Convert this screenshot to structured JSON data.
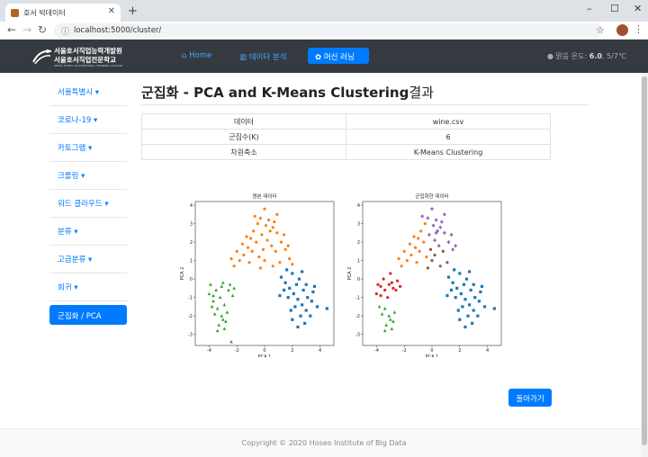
{
  "browser": {
    "tab_title": "호서 빅데이터",
    "url": "localhost:5000/cluster/",
    "new_tab": "+",
    "minimize": "–",
    "maximize": "☐",
    "close": "✕"
  },
  "navbar": {
    "logo_line1": "서울호서직업능력개발원",
    "logo_line2": "서울호서직업전문학교",
    "logo_line3": "SEOUL HOSEO OCCUPATIONAL TRAINING COLLEGE",
    "home_label": "Home",
    "analysis_label": "데이터 분석",
    "ml_label": "머신 러닝",
    "weather_prefix": "맑음 온도:",
    "weather_temp": "6.0",
    "weather_range": ", 5/7℃"
  },
  "sidebar": {
    "items": [
      {
        "label": "서울특별시 ▾"
      },
      {
        "label": "코로나-19 ▾"
      },
      {
        "label": "카토그램 ▾"
      },
      {
        "label": "크롤링 ▾"
      },
      {
        "label": "워드 클라우드 ▾"
      },
      {
        "label": "분류 ▾"
      },
      {
        "label": "고급분류 ▾"
      },
      {
        "label": "회귀 ▾"
      },
      {
        "label": "군집화 / PCA"
      }
    ]
  },
  "main": {
    "title_bold": "군집화 - PCA and K-Means Clustering",
    "title_rest": "결과",
    "table": [
      [
        "데이터",
        "wine.csv"
      ],
      [
        "군집수(K)",
        "6"
      ],
      [
        "차원축소",
        "K-Means Clustering"
      ]
    ],
    "back_label": "돌아가기"
  },
  "chart_data": [
    {
      "type": "scatter",
      "title": "원본 데이터",
      "xlabel": "PCA 1",
      "ylabel": "PCA 2",
      "xlim": [
        -5,
        5
      ],
      "ylim": [
        -3.6,
        4.2
      ],
      "xticks": [
        -4,
        -2,
        0,
        2,
        4
      ],
      "yticks": [
        -3,
        -2,
        -1,
        0,
        1,
        2,
        3,
        4
      ],
      "series": [
        {
          "color": "#ff7f0e",
          "marker": "circle",
          "points": [
            [
              -2.2,
              0.7
            ],
            [
              -1.8,
              1.0
            ],
            [
              -1.5,
              1.3
            ],
            [
              -1.2,
              1.7
            ],
            [
              -1.0,
              2.2
            ],
            [
              -0.8,
              2.6
            ],
            [
              -0.5,
              3.0
            ],
            [
              -0.3,
              3.3
            ],
            [
              0.0,
              3.8
            ],
            [
              0.3,
              3.2
            ],
            [
              0.6,
              2.8
            ],
            [
              0.9,
              2.5
            ],
            [
              1.2,
              2.0
            ],
            [
              1.5,
              1.6
            ],
            [
              1.8,
              1.1
            ],
            [
              2.0,
              0.8
            ],
            [
              -0.6,
              2.0
            ],
            [
              -0.2,
              2.4
            ],
            [
              0.2,
              2.1
            ],
            [
              0.5,
              1.8
            ],
            [
              -0.9,
              1.5
            ],
            [
              -1.3,
              2.3
            ],
            [
              -0.4,
              1.2
            ],
            [
              0.8,
              1.5
            ],
            [
              1.1,
              0.9
            ],
            [
              0.1,
              2.9
            ],
            [
              -1.6,
              1.9
            ],
            [
              -2.0,
              1.5
            ],
            [
              0.7,
              3.1
            ],
            [
              -0.1,
              1.6
            ],
            [
              1.4,
              2.4
            ],
            [
              -0.7,
              3.4
            ],
            [
              0.4,
              2.6
            ],
            [
              -1.1,
              0.9
            ],
            [
              0.0,
              1.0
            ],
            [
              1.7,
              1.8
            ],
            [
              -2.4,
              1.1
            ],
            [
              0.9,
              3.5
            ],
            [
              -0.3,
              0.6
            ],
            [
              0.6,
              0.7
            ]
          ]
        },
        {
          "color": "#1f77b4",
          "marker": "square",
          "points": [
            [
              1.2,
              0.1
            ],
            [
              1.5,
              -0.2
            ],
            [
              1.8,
              -0.5
            ],
            [
              2.1,
              -0.8
            ],
            [
              2.4,
              -1.1
            ],
            [
              2.7,
              -1.4
            ],
            [
              3.0,
              -1.7
            ],
            [
              3.3,
              -2.0
            ],
            [
              2.0,
              0.3
            ],
            [
              2.5,
              0.0
            ],
            [
              3.0,
              -0.3
            ],
            [
              3.5,
              -0.7
            ],
            [
              1.7,
              -1.0
            ],
            [
              2.2,
              -1.5
            ],
            [
              2.8,
              -0.6
            ],
            [
              3.4,
              -1.2
            ],
            [
              1.4,
              -0.6
            ],
            [
              2.6,
              -2.0
            ],
            [
              3.8,
              -1.5
            ],
            [
              1.9,
              -1.7
            ],
            [
              2.3,
              -0.3
            ],
            [
              3.1,
              -1.0
            ],
            [
              2.9,
              -2.4
            ],
            [
              1.6,
              0.5
            ],
            [
              2.4,
              -2.6
            ],
            [
              3.6,
              -0.4
            ],
            [
              1.1,
              -0.9
            ],
            [
              4.5,
              -1.6
            ],
            [
              2.0,
              -2.2
            ],
            [
              2.7,
              0.4
            ]
          ]
        },
        {
          "color": "#2ca02c",
          "marker": "triangle",
          "points": [
            [
              -4.0,
              -0.8
            ],
            [
              -3.7,
              -1.2
            ],
            [
              -3.4,
              -1.6
            ],
            [
              -3.1,
              -2.0
            ],
            [
              -2.8,
              -2.3
            ],
            [
              -3.9,
              -0.3
            ],
            [
              -3.5,
              -0.6
            ],
            [
              -3.2,
              -1.0
            ],
            [
              -2.9,
              -1.4
            ],
            [
              -3.6,
              -1.9
            ],
            [
              -3.0,
              -0.2
            ],
            [
              -2.6,
              -0.6
            ],
            [
              -2.3,
              -0.9
            ],
            [
              -3.3,
              -2.5
            ],
            [
              -2.7,
              -1.8
            ],
            [
              -3.8,
              -1.5
            ],
            [
              -3.1,
              -0.4
            ],
            [
              -2.5,
              -0.3
            ],
            [
              -3.4,
              -2.8
            ],
            [
              -2.4,
              -3.4
            ],
            [
              -3.0,
              -2.2
            ],
            [
              -3.7,
              -0.9
            ],
            [
              -2.2,
              -0.5
            ],
            [
              -2.9,
              -2.7
            ]
          ]
        }
      ]
    },
    {
      "type": "scatter",
      "title": "군집화한 데이터",
      "xlabel": "PCA 1",
      "ylabel": "PCA 2",
      "xlim": [
        -5,
        5
      ],
      "ylim": [
        -3.6,
        4.2
      ],
      "xticks": [
        -4,
        -2,
        0,
        2,
        4
      ],
      "yticks": [
        -3,
        -2,
        -1,
        0,
        1,
        2,
        3,
        4
      ],
      "series": [
        {
          "color": "#ff7f0e",
          "marker": "circle",
          "points": [
            [
              -2.2,
              0.7
            ],
            [
              -1.8,
              1.0
            ],
            [
              -1.5,
              1.3
            ],
            [
              -1.2,
              1.7
            ],
            [
              -1.0,
              2.2
            ],
            [
              -0.8,
              2.6
            ],
            [
              -0.5,
              3.0
            ],
            [
              -0.6,
              2.0
            ],
            [
              -0.9,
              1.5
            ],
            [
              -1.3,
              2.3
            ],
            [
              -0.4,
              1.2
            ],
            [
              -1.6,
              1.9
            ],
            [
              -2.0,
              1.5
            ],
            [
              -1.1,
              0.9
            ],
            [
              -2.4,
              1.1
            ]
          ]
        },
        {
          "color": "#9467bd",
          "marker": "diamond",
          "points": [
            [
              0.0,
              3.8
            ],
            [
              0.3,
              3.2
            ],
            [
              0.6,
              2.8
            ],
            [
              0.9,
              2.5
            ],
            [
              1.2,
              2.0
            ],
            [
              1.5,
              1.6
            ],
            [
              -0.3,
              3.3
            ],
            [
              -0.2,
              2.4
            ],
            [
              0.2,
              2.1
            ],
            [
              0.5,
              1.8
            ],
            [
              0.1,
              2.9
            ],
            [
              0.7,
              3.1
            ],
            [
              1.4,
              2.4
            ],
            [
              0.4,
              2.6
            ],
            [
              0.9,
              3.5
            ],
            [
              -0.7,
              3.4
            ],
            [
              1.7,
              1.8
            ],
            [
              0.3,
              2.5
            ]
          ]
        },
        {
          "color": "#8c564b",
          "marker": "circle",
          "points": [
            [
              -0.1,
              1.6
            ],
            [
              0.0,
              1.0
            ],
            [
              0.6,
              0.7
            ],
            [
              -0.3,
              0.6
            ],
            [
              0.8,
              1.5
            ],
            [
              1.1,
              0.9
            ],
            [
              0.2,
              1.3
            ]
          ]
        },
        {
          "color": "#1f77b4",
          "marker": "square",
          "points": [
            [
              1.2,
              0.1
            ],
            [
              1.5,
              -0.2
            ],
            [
              1.8,
              -0.5
            ],
            [
              2.1,
              -0.8
            ],
            [
              2.4,
              -1.1
            ],
            [
              2.7,
              -1.4
            ],
            [
              3.0,
              -1.7
            ],
            [
              3.3,
              -2.0
            ],
            [
              2.0,
              0.3
            ],
            [
              2.5,
              0.0
            ],
            [
              3.0,
              -0.3
            ],
            [
              3.5,
              -0.7
            ],
            [
              1.7,
              -1.0
            ],
            [
              2.2,
              -1.5
            ],
            [
              2.8,
              -0.6
            ],
            [
              3.4,
              -1.2
            ],
            [
              1.4,
              -0.6
            ],
            [
              2.6,
              -2.0
            ],
            [
              3.8,
              -1.5
            ],
            [
              1.9,
              -1.7
            ],
            [
              2.3,
              -0.3
            ],
            [
              3.1,
              -1.0
            ],
            [
              2.9,
              -2.4
            ],
            [
              1.6,
              0.5
            ],
            [
              2.4,
              -2.6
            ],
            [
              3.6,
              -0.4
            ],
            [
              1.1,
              -0.9
            ],
            [
              4.5,
              -1.6
            ],
            [
              2.0,
              -2.2
            ],
            [
              2.7,
              0.4
            ]
          ]
        },
        {
          "color": "#d62728",
          "marker": "circle",
          "points": [
            [
              -4.0,
              -0.8
            ],
            [
              -3.7,
              -0.4
            ],
            [
              -3.4,
              -0.6
            ],
            [
              -3.1,
              -0.3
            ],
            [
              -2.8,
              -0.5
            ],
            [
              -3.9,
              -0.3
            ],
            [
              -3.5,
              0.0
            ],
            [
              -3.2,
              -1.0
            ],
            [
              -2.9,
              -0.2
            ],
            [
              -3.0,
              0.3
            ],
            [
              -2.6,
              -0.6
            ],
            [
              -2.3,
              -0.4
            ],
            [
              -3.7,
              -0.9
            ],
            [
              -2.5,
              -0.1
            ]
          ]
        },
        {
          "color": "#2ca02c",
          "marker": "triangle",
          "points": [
            [
              -3.4,
              -1.6
            ],
            [
              -3.1,
              -2.0
            ],
            [
              -2.8,
              -2.3
            ],
            [
              -3.6,
              -1.9
            ],
            [
              -3.3,
              -2.5
            ],
            [
              -2.7,
              -1.8
            ],
            [
              -3.8,
              -1.5
            ],
            [
              -3.4,
              -2.8
            ],
            [
              -3.0,
              -2.2
            ],
            [
              -2.9,
              -2.7
            ]
          ]
        }
      ]
    }
  ],
  "footer": {
    "copyright": "Copyright © 2020 Hoseo Institute of Big Data"
  }
}
